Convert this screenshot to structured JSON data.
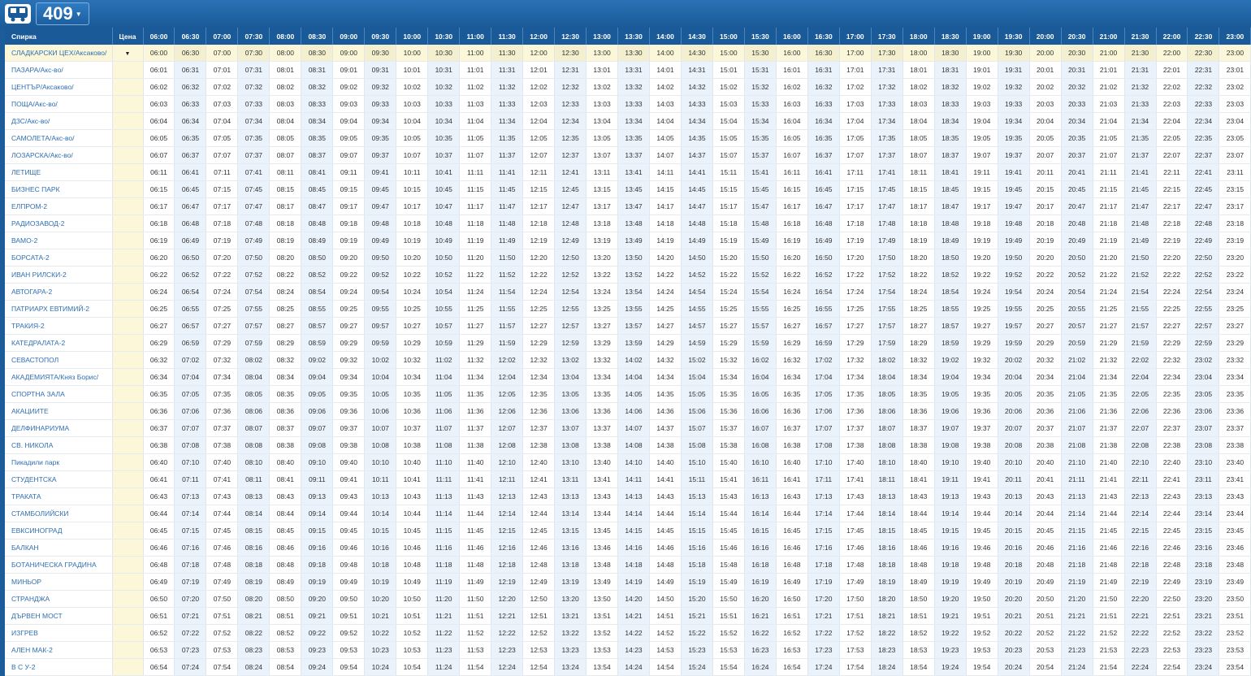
{
  "route": {
    "number": "409"
  },
  "headers": {
    "stop": "Спирка",
    "price": "Цена"
  },
  "columns": [
    "06:00",
    "06:30",
    "07:00",
    "07:30",
    "08:00",
    "08:30",
    "09:00",
    "09:30",
    "10:00",
    "10:30",
    "11:00",
    "11:30",
    "12:00",
    "12:30",
    "13:00",
    "13:30",
    "14:00",
    "14:30",
    "15:00",
    "15:30",
    "16:00",
    "16:30",
    "17:00",
    "17:30",
    "18:00",
    "18:30",
    "19:00",
    "19:30",
    "20:00",
    "20:30",
    "21:00",
    "21:30",
    "22:00",
    "22:30",
    "23:00"
  ],
  "price_dropdown_icon": "caret-down-icon",
  "stops": [
    {
      "name": "СЛАДКАРСКИ ЦЕХ/Аксаково/",
      "offset": 0
    },
    {
      "name": "ПАЗАРА/Акс-во/",
      "offset": 1
    },
    {
      "name": "ЦЕНТЪР/Аксаково/",
      "offset": 2
    },
    {
      "name": "ПОЩА/Акс-во/",
      "offset": 3
    },
    {
      "name": "ДЗС/Акс-во/",
      "offset": 4
    },
    {
      "name": "САМОЛЕТА/Акс-во/",
      "offset": 5
    },
    {
      "name": "ЛОЗАРСКА/Акс-во/",
      "offset": 7
    },
    {
      "name": "ЛЕТИЩЕ",
      "offset": 11
    },
    {
      "name": "БИЗНЕС ПАРК",
      "offset": 15
    },
    {
      "name": "ЕЛПРОМ-2",
      "offset": 17
    },
    {
      "name": "РАДИОЗАВОД-2",
      "offset": 18
    },
    {
      "name": "ВАМО-2",
      "offset": 19
    },
    {
      "name": "БОРСАТА-2",
      "offset": 20
    },
    {
      "name": "ИВАН РИЛСКИ-2",
      "offset": 22
    },
    {
      "name": "АВТОГАРА-2",
      "offset": 24
    },
    {
      "name": "ПАТРИАРХ ЕВТИМИЙ-2",
      "offset": 25
    },
    {
      "name": "ТРАКИЯ-2",
      "offset": 27
    },
    {
      "name": "КАТЕДРАЛАТА-2",
      "offset": 29
    },
    {
      "name": "СЕВАСТОПОЛ",
      "offset": 32
    },
    {
      "name": "АКАДЕМИЯТА/Княз Борис/",
      "offset": 34
    },
    {
      "name": "СПОРТНА ЗАЛА",
      "offset": 35
    },
    {
      "name": "АКАЦИИТЕ",
      "offset": 36
    },
    {
      "name": "ДЕЛФИНАРИУМА",
      "offset": 37
    },
    {
      "name": "СВ. НИКОЛА",
      "offset": 38
    },
    {
      "name": "Пикадили парк",
      "offset": 40
    },
    {
      "name": "СТУДЕНТСКА",
      "offset": 41
    },
    {
      "name": "ТРАКАТА",
      "offset": 43
    },
    {
      "name": "СТАМБОЛИЙСКИ",
      "offset": 44
    },
    {
      "name": "ЕВКСИНОГРАД",
      "offset": 45
    },
    {
      "name": "БАЛКАН",
      "offset": 46
    },
    {
      "name": "БОТАНИЧЕСКА ГРАДИНА",
      "offset": 48
    },
    {
      "name": "МИНЬОР",
      "offset": 49
    },
    {
      "name": "СТРАНДЖА",
      "offset": 50
    },
    {
      "name": "ДЪРВЕН МОСТ",
      "offset": 51
    },
    {
      "name": "ИЗГРЕВ",
      "offset": 52
    },
    {
      "name": "АЛЕН МАК-2",
      "offset": 53
    },
    {
      "name": "В С У-2",
      "offset": 54
    }
  ],
  "colors": {
    "header_bg": "#1a5a98",
    "first_row_bg": "#fbf7d8",
    "alt_col_bg": "#eaf2fb",
    "stop_text": "#2f6fb3"
  }
}
